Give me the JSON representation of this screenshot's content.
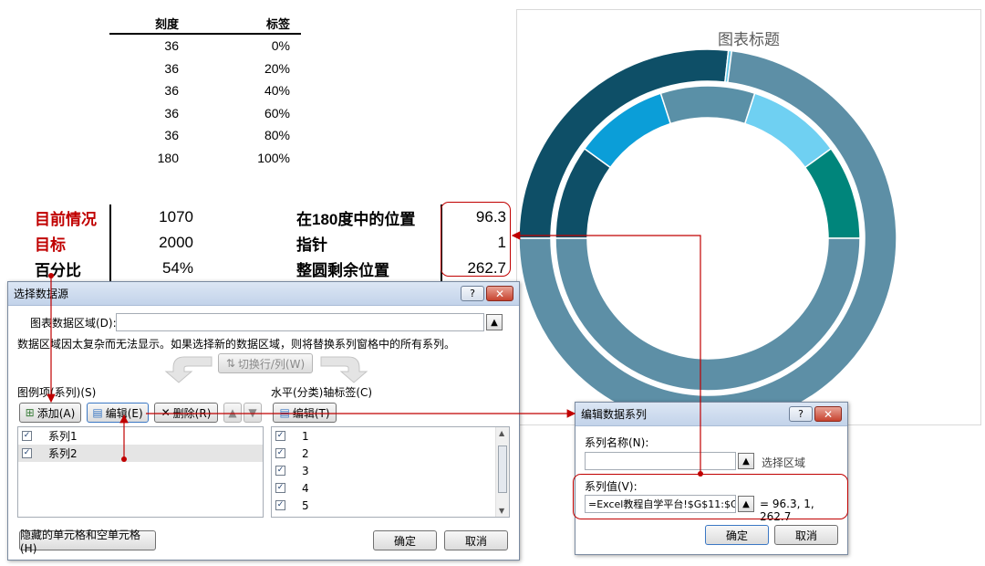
{
  "sheet": {
    "headers": [
      "刻度",
      "标签"
    ],
    "rows": [
      [
        "36",
        "0%"
      ],
      [
        "36",
        "20%"
      ],
      [
        "36",
        "40%"
      ],
      [
        "36",
        "60%"
      ],
      [
        "36",
        "80%"
      ],
      [
        "180",
        "100%"
      ]
    ],
    "left_stats": [
      {
        "label": "目前情况",
        "value": "1070",
        "red": true
      },
      {
        "label": "目标",
        "value": "2000",
        "red": true
      },
      {
        "label": "百分比",
        "value": "54%",
        "red": false
      }
    ],
    "right_stats": [
      {
        "label": "在180度中的位置",
        "value": "96.3"
      },
      {
        "label": "指针",
        "value": "1"
      },
      {
        "label": "整圆剩余位置",
        "value": "262.7"
      }
    ]
  },
  "chart": {
    "title": "图表标题"
  },
  "chart_data": {
    "type": "pie",
    "subtype": "doughnut",
    "title": "图表标题",
    "series": [
      {
        "values": [
          36,
          36,
          36,
          36,
          36,
          180
        ],
        "colors": [
          "#0e4f67",
          "#0b9ed8",
          "#5a90a7",
          "#6fd0f2",
          "#00857b",
          "#5d8fa6"
        ]
      },
      {
        "values": [
          96.3,
          1,
          262.7
        ],
        "colors": [
          "#0e4f67",
          "#5ec8e8",
          "#5d8fa6"
        ]
      }
    ],
    "start_angle_deg": 270
  },
  "select_dialog": {
    "title": "选择数据源",
    "help_btn": "?",
    "close_btn": "✕",
    "range_label": "图表数据区域(D):",
    "range_value": "",
    "warning": "数据区域因太复杂而无法显示。如果选择新的数据区域，则将替换系列窗格中的所有系列。",
    "switch_btn": "切换行/列(W)",
    "legend_label": "图例项(系列)(S)",
    "add_btn": "添加(A)",
    "edit_btn": "编辑(E)",
    "delete_btn": "删除(R)",
    "series_items": [
      {
        "label": "系列1",
        "checked": true,
        "selected": false
      },
      {
        "label": "系列2",
        "checked": true,
        "selected": true
      }
    ],
    "axis_label": "水平(分类)轴标签(C)",
    "axis_edit_btn": "编辑(T)",
    "axis_items": [
      "1",
      "2",
      "3",
      "4",
      "5"
    ],
    "hidden_btn": "隐藏的单元格和空单元格(H)",
    "ok_btn": "确定",
    "cancel_btn": "取消"
  },
  "edit_dialog": {
    "title": "编辑数据系列",
    "help_btn": "?",
    "close_btn": "✕",
    "name_label": "系列名称(N):",
    "name_value": "",
    "select_area": "选择区域",
    "values_label": "系列值(V):",
    "values_value": "=Excel教程自学平台!$G$11:$G",
    "values_preview": "= 96.3, 1, 262.7",
    "ok_btn": "确定",
    "cancel_btn": "取消"
  },
  "colors": {
    "annotation_red": "#c00000",
    "dark_teal": "#0e4f67",
    "outer_ring": "#5d8fa6"
  }
}
